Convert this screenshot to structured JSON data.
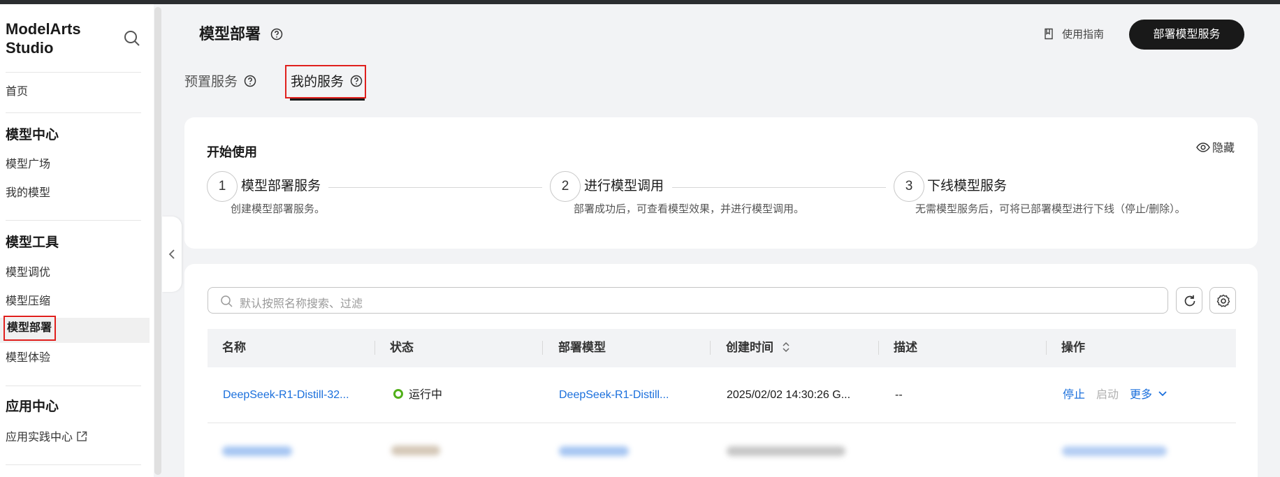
{
  "sidebar": {
    "brand_line1": "ModelArts",
    "brand_line2": "Studio",
    "home": "首页",
    "section1": "模型中心",
    "model_square": "模型广场",
    "my_models": "我的模型",
    "section2": "模型工具",
    "model_tuning": "模型调优",
    "model_compress": "模型压缩",
    "model_deploy": "模型部署",
    "model_experience": "模型体验",
    "section3": "应用中心",
    "app_practice": "应用实践中心"
  },
  "header": {
    "title": "模型部署",
    "guide": "使用指南",
    "deploy_button": "部署模型服务"
  },
  "tabs": {
    "preset": "预置服务",
    "mine": "我的服务"
  },
  "getting_started": {
    "title": "开始使用",
    "hide": "隐藏",
    "steps": [
      {
        "num": "1",
        "title": "模型部署服务",
        "desc": "创建模型部署服务。"
      },
      {
        "num": "2",
        "title": "进行模型调用",
        "desc": "部署成功后，可查看模型效果，并进行模型调用。"
      },
      {
        "num": "3",
        "title": "下线模型服务",
        "desc": "无需模型服务后，可将已部署模型进行下线（停止/删除）。"
      }
    ]
  },
  "table": {
    "search_placeholder": "默认按照名称搜索、过滤",
    "columns": [
      "名称",
      "状态",
      "部署模型",
      "创建时间",
      "描述",
      "操作"
    ],
    "rows": [
      {
        "name": "DeepSeek-R1-Distill-32...",
        "status": "运行中",
        "model": "DeepSeek-R1-Distill...",
        "created": "2025/02/02 14:30:26 G...",
        "desc": "--",
        "action_stop": "停止",
        "action_start": "启动",
        "action_more": "更多"
      }
    ]
  },
  "colors": {
    "accent_link": "#1a6fdc",
    "running_green": "#52b01a",
    "highlight_red": "#e0201d",
    "primary_button": "#191919"
  }
}
